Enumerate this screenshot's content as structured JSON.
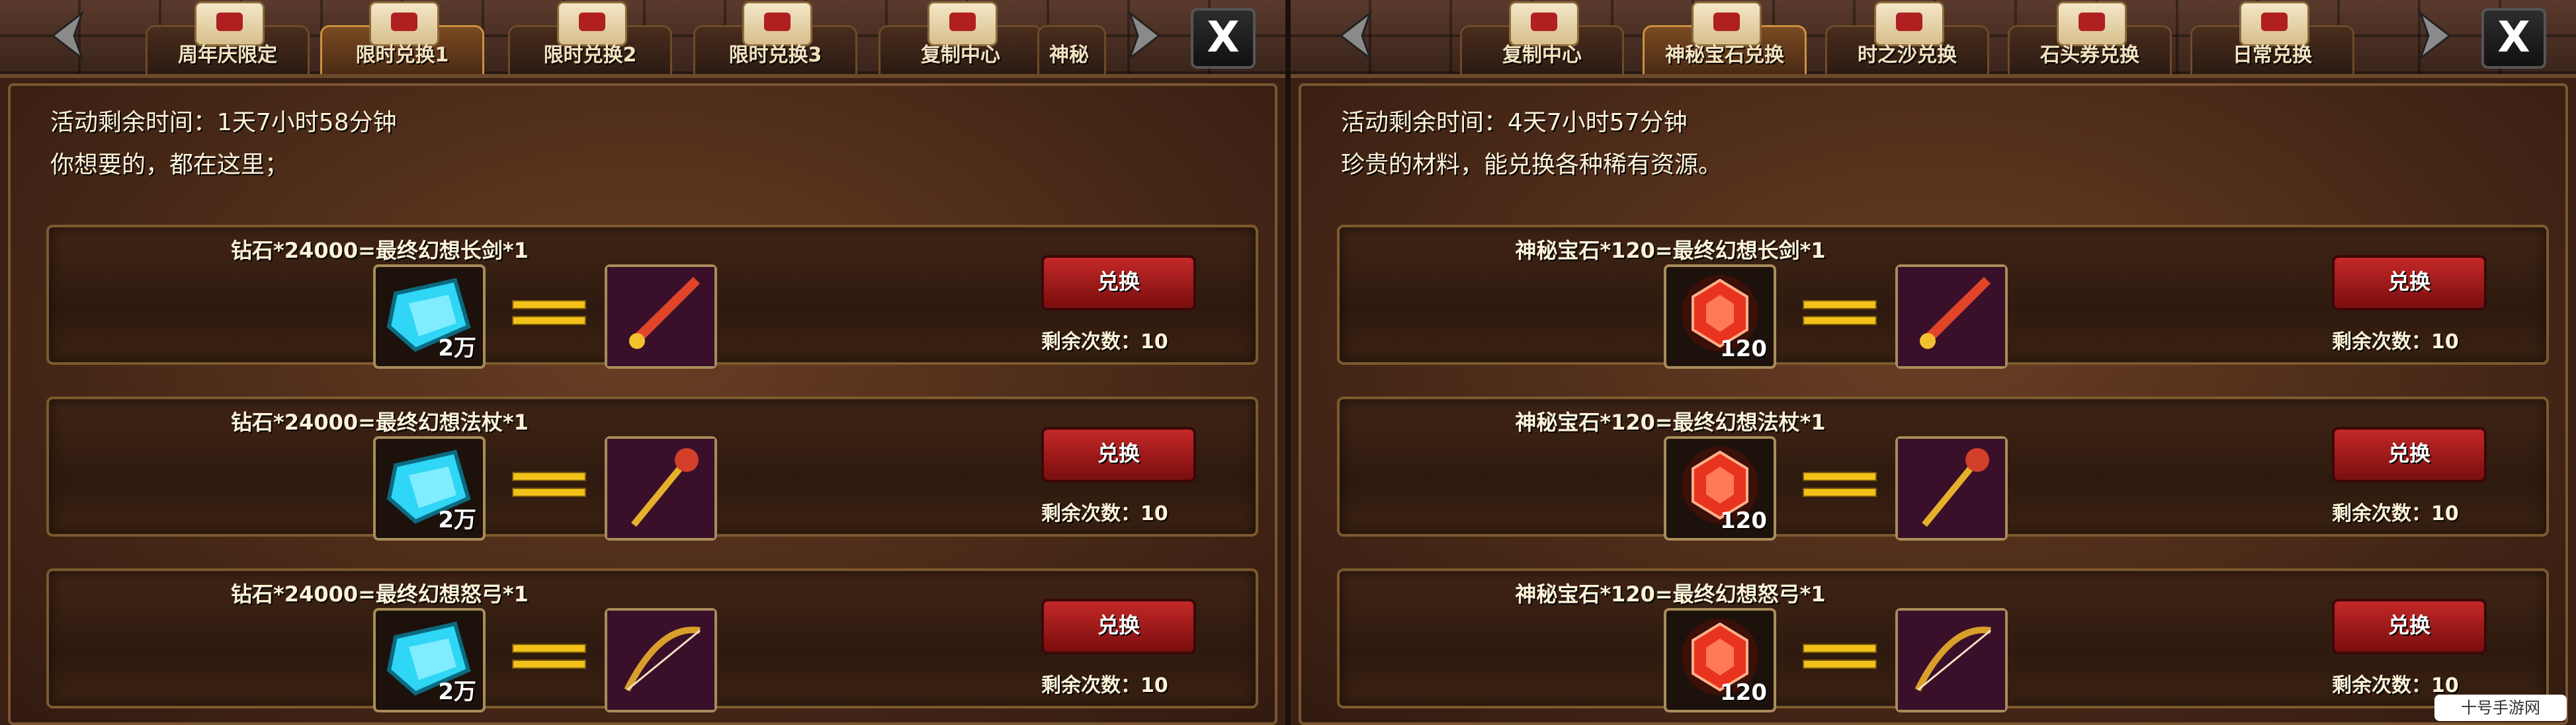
{
  "left_panel": {
    "tabs": [
      "周年庆限定",
      "限时兑换1",
      "限时兑换2",
      "限时兑换3",
      "复制中心",
      "神秘"
    ],
    "active_tab": 1,
    "time_text": "活动剩余时间：1天7小时58分钟",
    "desc_text": "你想要的，都在这里；",
    "rows": [
      {
        "title": "钻石*24000=最终幻想长剑*1",
        "cost_qty": "2万",
        "button": "兑换",
        "remain": "剩余次数：10"
      },
      {
        "title": "钻石*24000=最终幻想法杖*1",
        "cost_qty": "2万",
        "button": "兑换",
        "remain": "剩余次数：10"
      },
      {
        "title": "钻石*24000=最终幻想怒弓*1",
        "cost_qty": "2万",
        "button": "兑换",
        "remain": "剩余次数：10"
      }
    ],
    "close_label": "X"
  },
  "right_panel": {
    "tabs": [
      "复制中心",
      "神秘宝石兑换",
      "时之沙兑换",
      "石头券兑换",
      "日常兑换"
    ],
    "active_tab": 1,
    "time_text": "活动剩余时间：4天7小时57分钟",
    "desc_text": "珍贵的材料，能兑换各种稀有资源。",
    "rows": [
      {
        "title": "神秘宝石*120=最终幻想长剑*1",
        "cost_qty": "120",
        "button": "兑换",
        "remain": "剩余次数：10"
      },
      {
        "title": "神秘宝石*120=最终幻想法杖*1",
        "cost_qty": "120",
        "button": "兑换",
        "remain": "剩余次数：10"
      },
      {
        "title": "神秘宝石*120=最终幻想怒弓*1",
        "cost_qty": "120",
        "button": "兑换",
        "remain": "剩余次数：10"
      }
    ],
    "close_label": "X"
  },
  "watermark": "十号手游网",
  "colors": {
    "accent_gold": "#f3c21a",
    "button_red": "#c42828",
    "text_cream": "#fff3d9"
  },
  "icons": {
    "left_cost": "diamond-icon",
    "right_cost": "ruby-gem-icon",
    "rewards": [
      "sword-icon",
      "staff-icon",
      "bow-icon"
    ]
  }
}
